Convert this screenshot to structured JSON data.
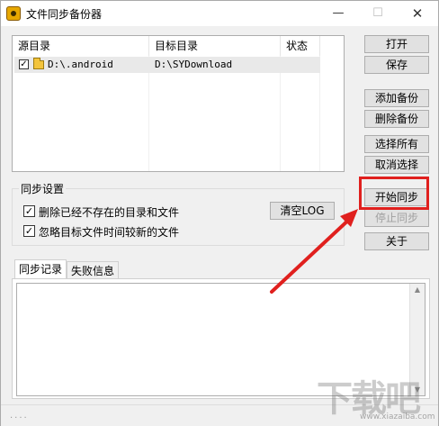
{
  "window": {
    "title": "文件同步备份器",
    "minimize_glyph": "—",
    "maximize_glyph": "☐",
    "close_glyph": "✕"
  },
  "list": {
    "headers": [
      "源目录",
      "目标目录",
      "状态"
    ],
    "rows": [
      {
        "checked": true,
        "source": "D:\\.android",
        "target": "D:\\SYDownload",
        "status": ""
      }
    ]
  },
  "buttons": {
    "open": "打开",
    "save": "保存",
    "add_backup": "添加备份",
    "delete_backup": "删除备份",
    "select_all": "选择所有",
    "deselect": "取消选择",
    "start_sync": "开始同步",
    "stop_sync": "停止同步",
    "about": "关于"
  },
  "sync_settings": {
    "title": "同步设置",
    "options": [
      {
        "label": "删除已经不存在的目录和文件",
        "checked": true
      },
      {
        "label": "忽略目标文件时间较新的文件",
        "checked": true
      }
    ],
    "clear_log": "清空LOG"
  },
  "tabs": [
    "同步记录",
    "失败信息"
  ],
  "active_tab": 0,
  "statusbar": {
    "text": "...."
  },
  "annotation": {
    "color": "#e0201e"
  },
  "watermark": {
    "logo_text": "下载吧",
    "url": "www.xiazaiba.com"
  }
}
